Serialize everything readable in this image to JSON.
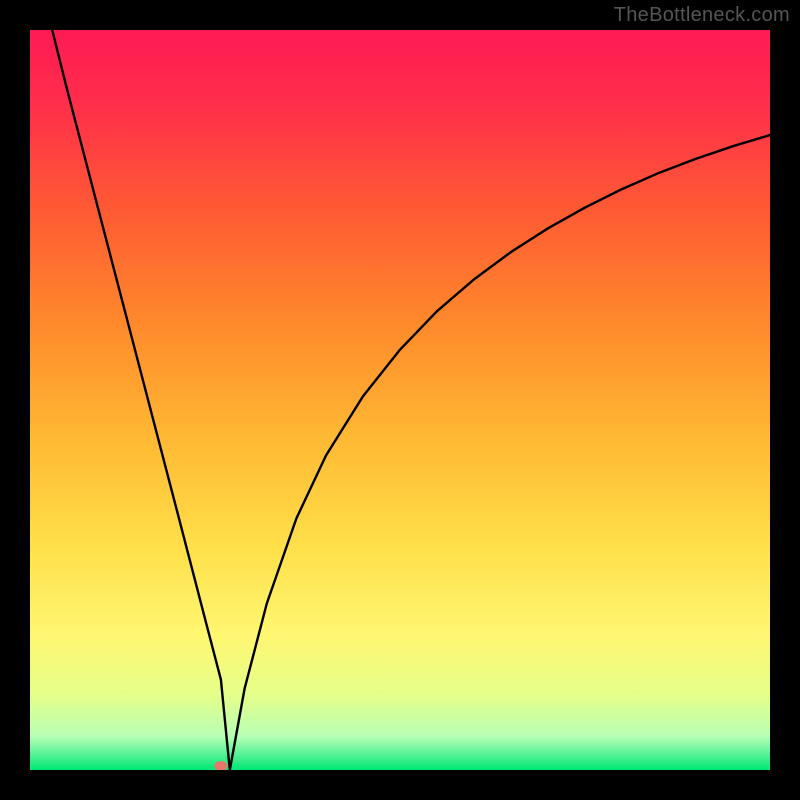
{
  "attribution": "TheBottleneck.com",
  "chart_data": {
    "type": "line",
    "title": "",
    "xlabel": "",
    "ylabel": "",
    "xlim": [
      0,
      100
    ],
    "ylim": [
      0,
      100
    ],
    "grid": false,
    "legend": false,
    "series": [
      {
        "name": "curve",
        "x": [
          3,
          5,
          8,
          11,
          14,
          17,
          20,
          22,
          24,
          25.8,
          27,
          29,
          32,
          36,
          40,
          45,
          50,
          55,
          60,
          65,
          70,
          75,
          80,
          85,
          90,
          95,
          100
        ],
        "y": [
          100,
          92,
          80.5,
          69,
          57.5,
          46,
          34.5,
          26.8,
          19.1,
          12.2,
          0,
          11,
          22.5,
          34,
          42.5,
          50.5,
          56.8,
          62,
          66.3,
          70,
          73.2,
          76,
          78.5,
          80.7,
          82.6,
          84.3,
          85.8
        ]
      }
    ],
    "marker": {
      "x": 25.8,
      "y": 0
    },
    "gradient_stops": [
      {
        "offset": 0.0,
        "color": "#ff1a55"
      },
      {
        "offset": 0.1,
        "color": "#ff2e4a"
      },
      {
        "offset": 0.25,
        "color": "#ff5c33"
      },
      {
        "offset": 0.4,
        "color": "#ff8a2b"
      },
      {
        "offset": 0.55,
        "color": "#ffb833"
      },
      {
        "offset": 0.7,
        "color": "#ffe04a"
      },
      {
        "offset": 0.82,
        "color": "#fff772"
      },
      {
        "offset": 0.9,
        "color": "#e4ff8a"
      },
      {
        "offset": 0.955,
        "color": "#b6ffb6"
      },
      {
        "offset": 1.0,
        "color": "#00e676"
      }
    ]
  }
}
